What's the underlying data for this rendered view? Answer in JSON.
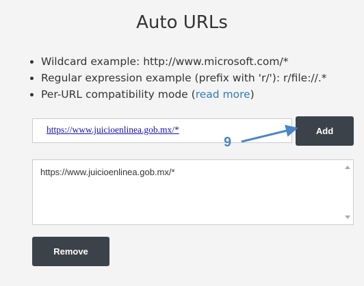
{
  "title": "Auto URLs",
  "bullets": [
    "Wildcard example: http://www.microsoft.com/*",
    "Regular expression example (prefix with 'r/'): r/file://.*",
    "Per-URL compatibility mode ("
  ],
  "read_more_link": "read more",
  "bullet3_suffix": ")",
  "url_input": {
    "value": "https://www.juicioenlinea.gob.mx/*"
  },
  "add_button": "Add",
  "annotation": {
    "number": "9",
    "color": "#4a86c5"
  },
  "url_list": {
    "items": [
      "https://www.juicioenlinea.gob.mx/*"
    ]
  },
  "remove_button": "Remove",
  "colors": {
    "button_bg": "#3b4249",
    "link": "#2f7bb5",
    "background": "#f4f4f4"
  }
}
